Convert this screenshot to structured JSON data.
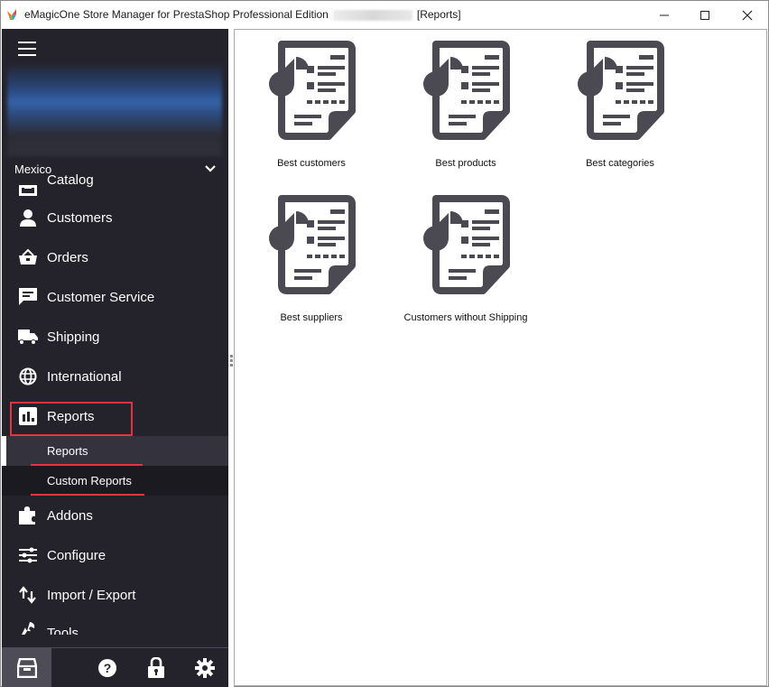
{
  "window": {
    "title_prefix": "eMagicOne Store Manager for PrestaShop Professional Edition",
    "title_suffix": "[Reports]",
    "controls": {
      "minimize": "—",
      "maximize": "☐",
      "close": "✕"
    }
  },
  "sidebar": {
    "store_name": "Mexico",
    "items": [
      {
        "label": "Catalog",
        "icon": "catalog-icon"
      },
      {
        "label": "Customers",
        "icon": "user-icon"
      },
      {
        "label": "Orders",
        "icon": "basket-icon"
      },
      {
        "label": "Customer Service",
        "icon": "chat-icon"
      },
      {
        "label": "Shipping",
        "icon": "truck-icon"
      },
      {
        "label": "International",
        "icon": "globe-icon"
      },
      {
        "label": "Reports",
        "icon": "bar-chart-icon",
        "expanded": true
      },
      {
        "label": "Addons",
        "icon": "puzzle-icon"
      },
      {
        "label": "Configure",
        "icon": "sliders-icon"
      },
      {
        "label": "Import / Export",
        "icon": "arrows-icon"
      },
      {
        "label": "Tools",
        "icon": "wrench-icon"
      }
    ],
    "reports_subitems": [
      {
        "label": "Reports",
        "active": true
      },
      {
        "label": "Custom Reports",
        "active": false
      }
    ],
    "bottom_buttons": [
      "store-icon",
      "help-icon",
      "lock-icon",
      "gear-icon"
    ]
  },
  "reports": [
    {
      "label": "Best customers"
    },
    {
      "label": "Best products"
    },
    {
      "label": "Best categories"
    },
    {
      "label": "Best suppliers"
    },
    {
      "label": "Customers without Shipping"
    }
  ],
  "colors": {
    "sidebar_bg": "#24232c",
    "highlight_red": "#e3343f",
    "icon_gray": "#4b4a52"
  }
}
